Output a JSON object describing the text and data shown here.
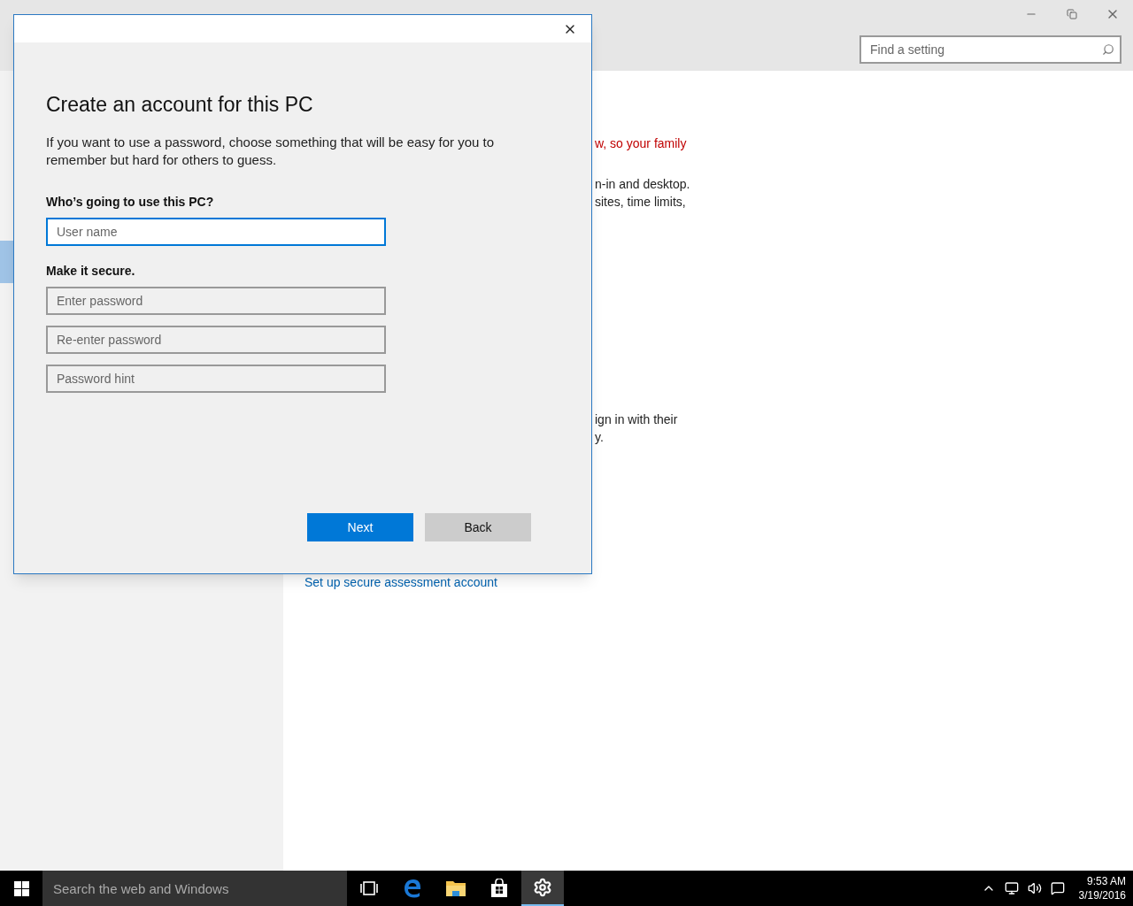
{
  "background_window": {
    "search": {
      "placeholder": "Find a setting"
    },
    "paragraphs": [
      {
        "kind": "warning",
        "lines": [
          "w, so your family"
        ]
      },
      {
        "kind": "text",
        "lines": [
          "n-in and desktop.",
          "sites, time limits,"
        ]
      },
      {
        "kind": "text",
        "lines": [
          "ign in with their",
          "y."
        ]
      }
    ],
    "link": "Set up secure assessment account"
  },
  "dialog": {
    "title": "Create an account for this PC",
    "intro": "If you want to use a password, choose something that will be easy for you to remember but hard for others to guess.",
    "sections": [
      {
        "heading": "Who’s going to use this PC?",
        "fields": [
          {
            "placeholder": "User name",
            "focused": true
          }
        ]
      },
      {
        "heading": "Make it secure.",
        "fields": [
          {
            "placeholder": "Enter password",
            "focused": false
          },
          {
            "placeholder": "Re-enter password",
            "focused": false
          },
          {
            "placeholder": "Password hint",
            "focused": false
          }
        ]
      }
    ],
    "buttons": [
      {
        "label": "Next",
        "primary": true
      },
      {
        "label": "Back",
        "primary": false
      }
    ]
  },
  "taskbar": {
    "search": {
      "placeholder": "Search the web and Windows"
    },
    "apps": [
      {
        "kind": "task-view",
        "active": false
      },
      {
        "kind": "browser",
        "active": false
      },
      {
        "kind": "folder",
        "active": false
      },
      {
        "kind": "store",
        "active": false
      },
      {
        "kind": "settings",
        "active": true
      }
    ],
    "time": "9:53 AM",
    "date": "3/19/2016"
  }
}
